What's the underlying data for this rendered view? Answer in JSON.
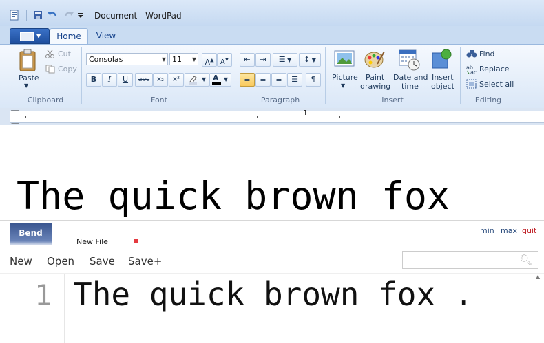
{
  "window": {
    "title": "Document - WordPad"
  },
  "quick_access": {
    "icons": [
      "wordpad-app-icon",
      "save-icon",
      "undo-icon",
      "redo-icon",
      "customize-qat-icon"
    ]
  },
  "tabs": [
    {
      "label": "Home",
      "active": true
    },
    {
      "label": "View",
      "active": false
    }
  ],
  "ribbon": {
    "clipboard": {
      "label": "Clipboard",
      "paste": "Paste",
      "cut": "Cut",
      "copy": "Copy"
    },
    "font": {
      "label": "Font",
      "family": "Consolas",
      "size": "11",
      "bold": "B",
      "italic": "I",
      "underline": "U",
      "strike": "abc",
      "subscript": "x₂",
      "superscript": "x²"
    },
    "paragraph": {
      "label": "Paragraph"
    },
    "insert": {
      "label": "Insert",
      "picture": "Picture",
      "paint_line1": "Paint",
      "paint_line2": "drawing",
      "datetime_line1": "Date and",
      "datetime_line2": "time",
      "object_line1": "Insert",
      "object_line2": "object"
    },
    "editing": {
      "label": "Editing",
      "find": "Find",
      "replace": "Replace",
      "select_all": "Select all"
    }
  },
  "ruler": {
    "number": "1"
  },
  "document": {
    "text": "The quick brown fox"
  },
  "bend": {
    "logo": "Bend",
    "file_tab": "New File",
    "window_buttons": {
      "min": "min",
      "max": "max",
      "quit": "quit"
    },
    "menu": [
      "New",
      "Open",
      "Save",
      "Save+"
    ],
    "search_placeholder": "",
    "line_number": "1",
    "line_text": "The quick brown fox ."
  },
  "colors": {
    "ribbon_bg": "#dae7f7",
    "title_bg": "#c5d9f1",
    "accent_blue": "#1f4f9e",
    "quit_red": "#c2262c",
    "unsaved_dot": "#e5393f"
  }
}
